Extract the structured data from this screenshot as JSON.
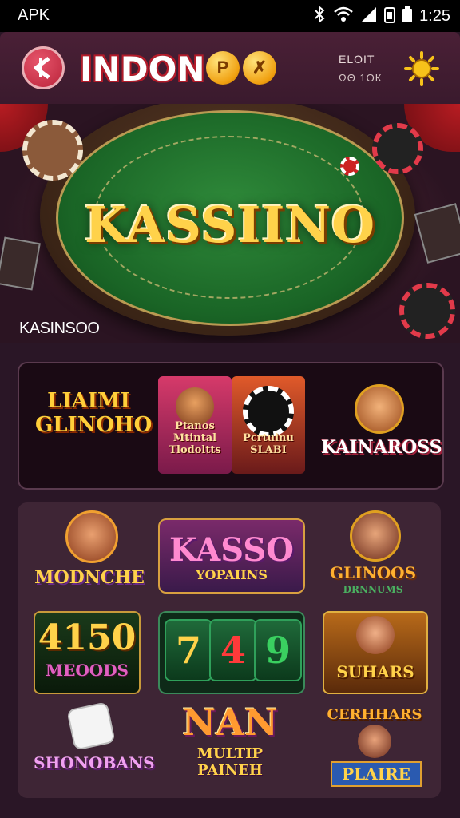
{
  "status_bar": {
    "left_label": "APK",
    "time": "1:25"
  },
  "header": {
    "brand": "INDON",
    "coin_a": "P",
    "coin_b": "✗",
    "balance_label": "ELOIT",
    "balance_value": "ΩΘ 1ΟК"
  },
  "hero": {
    "title": "KASSIINO",
    "caption": "KASINSOO"
  },
  "featured": {
    "items": [
      {
        "title": "LIAIMI GLINOHO"
      },
      {
        "title": "Ptanos Mtintal Tlodoltts"
      },
      {
        "title": "Pcrtuinu SLABI"
      },
      {
        "title": "KAINAROSS"
      }
    ]
  },
  "games": {
    "row1": [
      {
        "title": "MODNCHE"
      },
      {
        "title": "KASSO",
        "sub": "YOPAIINS"
      },
      {
        "title": "GLINOOS",
        "sub": "DRNNUMS"
      }
    ],
    "row2": [
      {
        "title": "4150",
        "sub": "MEOODS"
      },
      {
        "title": "",
        "reels": [
          "7",
          "4",
          "9"
        ]
      },
      {
        "title": "SUHARS"
      }
    ],
    "row3": [
      {
        "title": "SHONOBANS"
      },
      {
        "title": "NAN",
        "sub": "MULTIP PAINEH"
      },
      {
        "title": "CERHHARS",
        "sub": "PLAIRE"
      }
    ]
  }
}
